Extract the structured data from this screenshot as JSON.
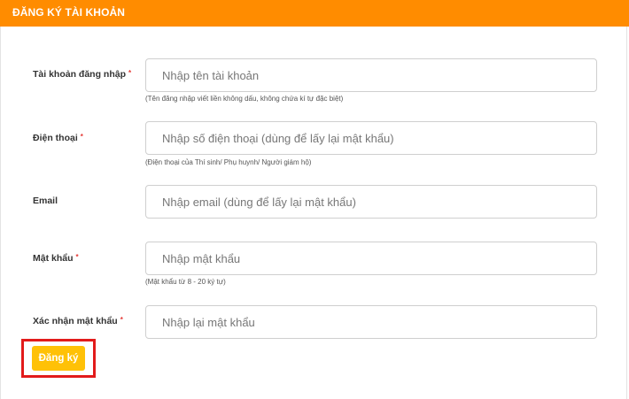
{
  "header": {
    "title": "ĐĂNG KÝ TÀI KHOẢN"
  },
  "form": {
    "username": {
      "label": "Tài khoản đăng nhập",
      "required_mark": "*",
      "placeholder": "Nhập tên tài khoản",
      "hint": "(Tên đăng nhập viết liền không dấu, không chứa kí tự đặc biệt)"
    },
    "phone": {
      "label": "Điện thoại",
      "required_mark": "*",
      "placeholder": "Nhập số điện thoại (dùng để lấy lại mật khẩu)",
      "hint": "(Điện thoại của Thí sinh/ Phụ huynh/ Người giám hộ)"
    },
    "email": {
      "label": "Email",
      "placeholder": "Nhập email (dùng để lấy lại mật khẩu)"
    },
    "password": {
      "label": "Mật khẩu",
      "required_mark": "*",
      "placeholder": "Nhập mật khẩu",
      "hint": "(Mật khẩu từ 8 - 20 ký tự)"
    },
    "confirm_password": {
      "label": "Xác nhận mật khẩu",
      "required_mark": "*",
      "placeholder": "Nhập lại mật khẩu"
    },
    "submit_label": "Đăng ký"
  },
  "colors": {
    "header": "#ff8c00",
    "button": "#ffc107",
    "highlight_frame": "#e21b1b",
    "required": "#e53935"
  }
}
